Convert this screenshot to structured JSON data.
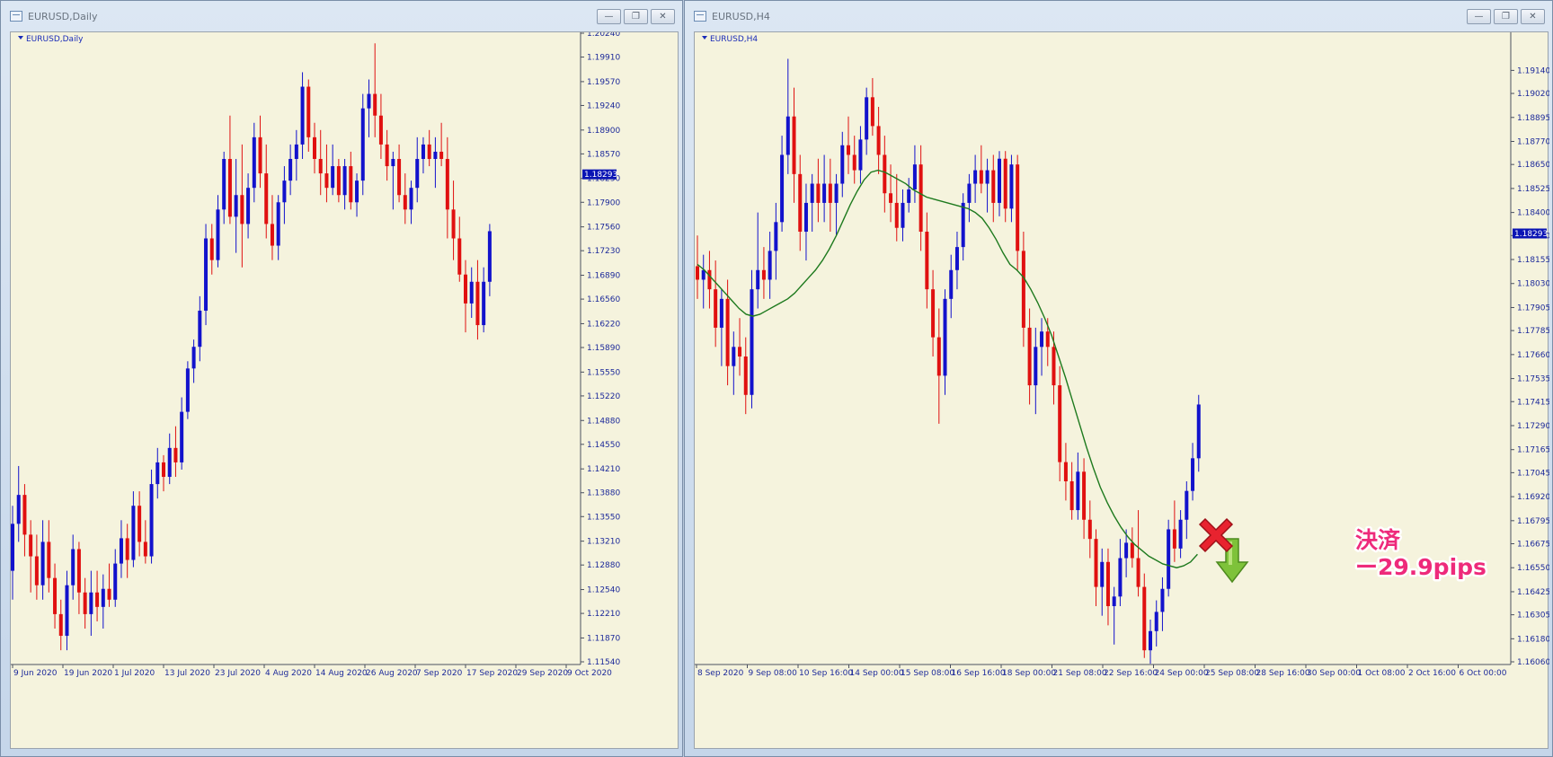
{
  "windows": [
    {
      "title": "EURUSD,Daily",
      "symbol": "EURUSD,Daily"
    },
    {
      "title": "EURUSD,H4",
      "symbol": "EURUSD,H4"
    }
  ],
  "buttons": {
    "minimize": "—",
    "restore": "❐",
    "close": "✕"
  },
  "colors": {
    "background": "#f5f3dd",
    "bull": "#1212cc",
    "bear": "#e01010",
    "moving_average": "#1e7a1e",
    "axis_text": "#1d2a9a",
    "price_tag": "#0a14b4",
    "annotation": "#ee2a7b"
  },
  "icons": {
    "entry": "green-down-arrow-icon",
    "exit": "red-x-icon"
  },
  "annotation": {
    "line1": "決済",
    "line2": "ー29.9pips"
  },
  "chart_data": [
    {
      "type": "candlestick",
      "symbol": "EURUSD,Daily",
      "current_price": "1.18293",
      "ylim": [
        1.1154,
        1.2024
      ],
      "y_ticks": [
        "1.20240",
        "1.19910",
        "1.19570",
        "1.19240",
        "1.18900",
        "1.18570",
        "1.18230",
        "1.17900",
        "1.17560",
        "1.17230",
        "1.16890",
        "1.16560",
        "1.16220",
        "1.15890",
        "1.15550",
        "1.15220",
        "1.14880",
        "1.14550",
        "1.14210",
        "1.13880",
        "1.13550",
        "1.13210",
        "1.12880",
        "1.12540",
        "1.12210",
        "1.11870",
        "1.11540"
      ],
      "x_ticks": [
        "9 Jun 2020",
        "19 Jun 2020",
        "1 Jul 2020",
        "13 Jul 2020",
        "23 Jul 2020",
        "4 Aug 2020",
        "14 Aug 2020",
        "26 Aug 2020",
        "7 Sep 2020",
        "17 Sep 2020",
        "29 Sep 2020",
        "9 Oct 2020"
      ],
      "ohlc": [
        [
          1.128,
          1.137,
          1.124,
          1.1345
        ],
        [
          1.1345,
          1.1425,
          1.132,
          1.1385
        ],
        [
          1.1385,
          1.14,
          1.13,
          1.133
        ],
        [
          1.133,
          1.135,
          1.125,
          1.13
        ],
        [
          1.13,
          1.133,
          1.124,
          1.126
        ],
        [
          1.126,
          1.135,
          1.124,
          1.132
        ],
        [
          1.132,
          1.135,
          1.125,
          1.127
        ],
        [
          1.127,
          1.129,
          1.12,
          1.122
        ],
        [
          1.122,
          1.124,
          1.117,
          1.119
        ],
        [
          1.119,
          1.128,
          1.117,
          1.126
        ],
        [
          1.126,
          1.133,
          1.124,
          1.131
        ],
        [
          1.131,
          1.132,
          1.122,
          1.125
        ],
        [
          1.125,
          1.127,
          1.12,
          1.122
        ],
        [
          1.122,
          1.128,
          1.119,
          1.125
        ],
        [
          1.125,
          1.128,
          1.121,
          1.123
        ],
        [
          1.123,
          1.1275,
          1.12,
          1.1255
        ],
        [
          1.1255,
          1.129,
          1.123,
          1.124
        ],
        [
          1.124,
          1.131,
          1.123,
          1.129
        ],
        [
          1.129,
          1.135,
          1.127,
          1.1325
        ],
        [
          1.1325,
          1.1345,
          1.127,
          1.1295
        ],
        [
          1.1295,
          1.139,
          1.1285,
          1.137
        ],
        [
          1.137,
          1.139,
          1.13,
          1.132
        ],
        [
          1.132,
          1.135,
          1.129,
          1.13
        ],
        [
          1.13,
          1.142,
          1.129,
          1.14
        ],
        [
          1.14,
          1.145,
          1.138,
          1.143
        ],
        [
          1.143,
          1.144,
          1.139,
          1.141
        ],
        [
          1.141,
          1.147,
          1.14,
          1.145
        ],
        [
          1.145,
          1.148,
          1.141,
          1.143
        ],
        [
          1.143,
          1.152,
          1.142,
          1.15
        ],
        [
          1.15,
          1.157,
          1.149,
          1.156
        ],
        [
          1.156,
          1.16,
          1.154,
          1.159
        ],
        [
          1.159,
          1.166,
          1.157,
          1.164
        ],
        [
          1.164,
          1.176,
          1.162,
          1.174
        ],
        [
          1.174,
          1.176,
          1.169,
          1.171
        ],
        [
          1.171,
          1.18,
          1.17,
          1.178
        ],
        [
          1.178,
          1.186,
          1.176,
          1.185
        ],
        [
          1.185,
          1.191,
          1.176,
          1.177
        ],
        [
          1.177,
          1.185,
          1.172,
          1.18
        ],
        [
          1.18,
          1.187,
          1.17,
          1.176
        ],
        [
          1.176,
          1.183,
          1.174,
          1.181
        ],
        [
          1.181,
          1.19,
          1.179,
          1.188
        ],
        [
          1.188,
          1.191,
          1.181,
          1.183
        ],
        [
          1.183,
          1.187,
          1.174,
          1.176
        ],
        [
          1.176,
          1.18,
          1.171,
          1.173
        ],
        [
          1.173,
          1.18,
          1.171,
          1.179
        ],
        [
          1.179,
          1.184,
          1.176,
          1.182
        ],
        [
          1.182,
          1.187,
          1.18,
          1.185
        ],
        [
          1.185,
          1.189,
          1.182,
          1.187
        ],
        [
          1.187,
          1.197,
          1.185,
          1.195
        ],
        [
          1.195,
          1.196,
          1.186,
          1.188
        ],
        [
          1.188,
          1.19,
          1.183,
          1.185
        ],
        [
          1.185,
          1.189,
          1.18,
          1.183
        ],
        [
          1.183,
          1.187,
          1.179,
          1.181
        ],
        [
          1.181,
          1.187,
          1.18,
          1.184
        ],
        [
          1.184,
          1.185,
          1.179,
          1.18
        ],
        [
          1.18,
          1.185,
          1.178,
          1.184
        ],
        [
          1.184,
          1.186,
          1.178,
          1.179
        ],
        [
          1.179,
          1.183,
          1.177,
          1.182
        ],
        [
          1.182,
          1.194,
          1.18,
          1.192
        ],
        [
          1.192,
          1.196,
          1.188,
          1.194
        ],
        [
          1.194,
          1.201,
          1.188,
          1.191
        ],
        [
          1.191,
          1.194,
          1.185,
          1.187
        ],
        [
          1.187,
          1.189,
          1.182,
          1.184
        ],
        [
          1.184,
          1.186,
          1.178,
          1.185
        ],
        [
          1.185,
          1.187,
          1.179,
          1.18
        ],
        [
          1.18,
          1.183,
          1.176,
          1.178
        ],
        [
          1.178,
          1.182,
          1.176,
          1.181
        ],
        [
          1.181,
          1.188,
          1.179,
          1.185
        ],
        [
          1.185,
          1.188,
          1.183,
          1.187
        ],
        [
          1.187,
          1.189,
          1.184,
          1.185
        ],
        [
          1.185,
          1.188,
          1.181,
          1.186
        ],
        [
          1.186,
          1.19,
          1.184,
          1.185
        ],
        [
          1.185,
          1.188,
          1.174,
          1.178
        ],
        [
          1.178,
          1.182,
          1.171,
          1.174
        ],
        [
          1.174,
          1.177,
          1.168,
          1.169
        ],
        [
          1.169,
          1.171,
          1.161,
          1.165
        ],
        [
          1.165,
          1.17,
          1.163,
          1.168
        ],
        [
          1.168,
          1.171,
          1.16,
          1.162
        ],
        [
          1.162,
          1.17,
          1.161,
          1.168
        ],
        [
          1.168,
          1.176,
          1.166,
          1.175
        ]
      ]
    },
    {
      "type": "candlestick",
      "symbol": "EURUSD,H4",
      "current_price": "1.18293",
      "ylim": [
        1.1606,
        1.1924
      ],
      "y_ticks": [
        "1.19140",
        "1.19020",
        "1.18895",
        "1.18770",
        "1.18650",
        "1.18525",
        "1.18400",
        "1.18280",
        "1.18155",
        "1.18030",
        "1.17905",
        "1.17785",
        "1.17660",
        "1.17535",
        "1.17415",
        "1.17290",
        "1.17165",
        "1.17045",
        "1.16920",
        "1.16795",
        "1.16675",
        "1.16550",
        "1.16425",
        "1.16305",
        "1.16180",
        "1.16060"
      ],
      "x_ticks": [
        "8 Sep 2020",
        "9 Sep 08:00",
        "10 Sep 16:00",
        "14 Sep 00:00",
        "15 Sep 08:00",
        "16 Sep 16:00",
        "18 Sep 00:00",
        "21 Sep 08:00",
        "22 Sep 16:00",
        "24 Sep 00:00",
        "25 Sep 08:00",
        "28 Sep 16:00",
        "30 Sep 00:00",
        "1 Oct 08:00",
        "2 Oct 16:00",
        "6 Oct 00:00"
      ],
      "ohlc": [
        [
          1.1812,
          1.1828,
          1.1795,
          1.1805
        ],
        [
          1.1805,
          1.1818,
          1.179,
          1.181
        ],
        [
          1.181,
          1.182,
          1.179,
          1.18
        ],
        [
          1.18,
          1.1815,
          1.177,
          1.178
        ],
        [
          1.178,
          1.18,
          1.176,
          1.1795
        ],
        [
          1.1795,
          1.1805,
          1.175,
          1.176
        ],
        [
          1.176,
          1.1778,
          1.1745,
          1.177
        ],
        [
          1.177,
          1.1785,
          1.1755,
          1.1765
        ],
        [
          1.1765,
          1.1775,
          1.1735,
          1.1745
        ],
        [
          1.1745,
          1.181,
          1.1738,
          1.18
        ],
        [
          1.18,
          1.184,
          1.179,
          1.181
        ],
        [
          1.181,
          1.1822,
          1.1795,
          1.1805
        ],
        [
          1.1805,
          1.183,
          1.1795,
          1.182
        ],
        [
          1.182,
          1.1845,
          1.1805,
          1.1835
        ],
        [
          1.1835,
          1.188,
          1.183,
          1.187
        ],
        [
          1.187,
          1.192,
          1.186,
          1.189
        ],
        [
          1.189,
          1.1905,
          1.1845,
          1.186
        ],
        [
          1.186,
          1.187,
          1.182,
          1.183
        ],
        [
          1.183,
          1.1855,
          1.1815,
          1.1845
        ],
        [
          1.1845,
          1.186,
          1.183,
          1.1855
        ],
        [
          1.1855,
          1.1868,
          1.1835,
          1.1845
        ],
        [
          1.1845,
          1.187,
          1.1835,
          1.1855
        ],
        [
          1.1855,
          1.1868,
          1.183,
          1.1845
        ],
        [
          1.1845,
          1.186,
          1.1828,
          1.1855
        ],
        [
          1.1855,
          1.1882,
          1.1848,
          1.1875
        ],
        [
          1.1875,
          1.189,
          1.186,
          1.187
        ],
        [
          1.187,
          1.188,
          1.1855,
          1.1862
        ],
        [
          1.1862,
          1.1885,
          1.1855,
          1.1878
        ],
        [
          1.1878,
          1.1905,
          1.187,
          1.19
        ],
        [
          1.19,
          1.191,
          1.188,
          1.1885
        ],
        [
          1.1885,
          1.1895,
          1.186,
          1.187
        ],
        [
          1.187,
          1.188,
          1.184,
          1.185
        ],
        [
          1.185,
          1.1865,
          1.1835,
          1.1845
        ],
        [
          1.1845,
          1.186,
          1.1825,
          1.1832
        ],
        [
          1.1832,
          1.1852,
          1.1825,
          1.1845
        ],
        [
          1.1845,
          1.1858,
          1.184,
          1.1852
        ],
        [
          1.1852,
          1.1875,
          1.1845,
          1.1865
        ],
        [
          1.1865,
          1.1875,
          1.182,
          1.183
        ],
        [
          1.183,
          1.184,
          1.179,
          1.18
        ],
        [
          1.18,
          1.181,
          1.1765,
          1.1775
        ],
        [
          1.1775,
          1.179,
          1.173,
          1.1755
        ],
        [
          1.1755,
          1.18,
          1.1745,
          1.1795
        ],
        [
          1.1795,
          1.1818,
          1.1785,
          1.181
        ],
        [
          1.181,
          1.183,
          1.18,
          1.1822
        ],
        [
          1.1822,
          1.185,
          1.1815,
          1.1845
        ],
        [
          1.1845,
          1.186,
          1.1835,
          1.1855
        ],
        [
          1.1855,
          1.187,
          1.1845,
          1.1862
        ],
        [
          1.1862,
          1.1875,
          1.185,
          1.1855
        ],
        [
          1.1855,
          1.1868,
          1.184,
          1.1862
        ],
        [
          1.1862,
          1.187,
          1.1835,
          1.1845
        ],
        [
          1.1845,
          1.1872,
          1.1838,
          1.1868
        ],
        [
          1.1868,
          1.1872,
          1.1835,
          1.1842
        ],
        [
          1.1842,
          1.187,
          1.1835,
          1.1865
        ],
        [
          1.1865,
          1.187,
          1.181,
          1.182
        ],
        [
          1.182,
          1.183,
          1.177,
          1.178
        ],
        [
          1.178,
          1.179,
          1.174,
          1.175
        ],
        [
          1.175,
          1.178,
          1.1735,
          1.177
        ],
        [
          1.177,
          1.1785,
          1.1755,
          1.1778
        ],
        [
          1.1778,
          1.1785,
          1.176,
          1.177
        ],
        [
          1.177,
          1.1778,
          1.174,
          1.175
        ],
        [
          1.175,
          1.176,
          1.17,
          1.171
        ],
        [
          1.171,
          1.172,
          1.169,
          1.17
        ],
        [
          1.17,
          1.171,
          1.168,
          1.1685
        ],
        [
          1.1685,
          1.1715,
          1.168,
          1.1705
        ],
        [
          1.1705,
          1.1712,
          1.167,
          1.168
        ],
        [
          1.168,
          1.169,
          1.166,
          1.167
        ],
        [
          1.167,
          1.1675,
          1.1635,
          1.1645
        ],
        [
          1.1645,
          1.1665,
          1.163,
          1.1658
        ],
        [
          1.1658,
          1.1665,
          1.1625,
          1.1635
        ],
        [
          1.1635,
          1.1645,
          1.1615,
          1.164
        ],
        [
          1.164,
          1.167,
          1.1635,
          1.166
        ],
        [
          1.166,
          1.1675,
          1.165,
          1.1668
        ],
        [
          1.1668,
          1.1676,
          1.1655,
          1.166
        ],
        [
          1.166,
          1.1685,
          1.164,
          1.1645
        ],
        [
          1.1645,
          1.1652,
          1.1608,
          1.1612
        ],
        [
          1.1612,
          1.1628,
          1.1605,
          1.1622
        ],
        [
          1.1622,
          1.1638,
          1.1614,
          1.1632
        ],
        [
          1.1632,
          1.165,
          1.1622,
          1.1644
        ],
        [
          1.1644,
          1.168,
          1.164,
          1.1675
        ],
        [
          1.1675,
          1.169,
          1.1658,
          1.1665
        ],
        [
          1.1665,
          1.1685,
          1.166,
          1.168
        ],
        [
          1.168,
          1.17,
          1.167,
          1.1695
        ],
        [
          1.1695,
          1.172,
          1.169,
          1.1712
        ],
        [
          1.1712,
          1.1745,
          1.1705,
          1.174
        ]
      ],
      "moving_average": [
        1.1813,
        1.181,
        1.1806,
        1.1802,
        1.1798,
        1.1794,
        1.179,
        1.1787,
        1.1786,
        1.1787,
        1.1789,
        1.1791,
        1.1793,
        1.1795,
        1.1798,
        1.1802,
        1.1806,
        1.181,
        1.1815,
        1.1821,
        1.1828,
        1.1836,
        1.1844,
        1.1851,
        1.1857,
        1.1861,
        1.1862,
        1.1861,
        1.1859,
        1.1857,
        1.1855,
        1.1852,
        1.185,
        1.1848,
        1.1847,
        1.1846,
        1.1845,
        1.1844,
        1.1843,
        1.1842,
        1.184,
        1.1837,
        1.1832,
        1.1826,
        1.1819,
        1.1813,
        1.181,
        1.1806,
        1.18,
        1.1793,
        1.1785,
        1.1776,
        1.1765,
        1.1754,
        1.1742,
        1.173,
        1.1718,
        1.1707,
        1.1697,
        1.1689,
        1.1682,
        1.1676,
        1.1671,
        1.1667,
        1.1664,
        1.1661,
        1.1659,
        1.1657,
        1.1656,
        1.1655,
        1.1656,
        1.1658,
        1.1662
      ]
    }
  ]
}
